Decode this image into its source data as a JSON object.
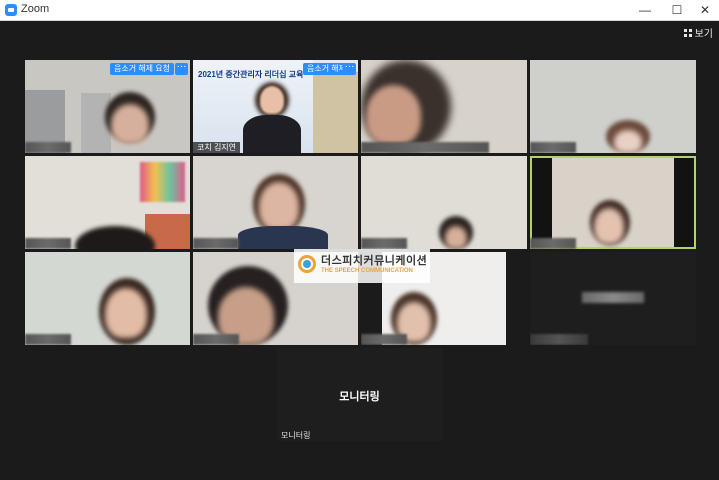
{
  "window": {
    "title": "Zoom",
    "minimize_icon": "minimize-icon",
    "maximize_icon": "maximize-icon",
    "close_icon": "close-icon"
  },
  "toolbar": {
    "view_label": "보기",
    "view_icon": "grid-view-icon"
  },
  "tiles": {
    "t1": {
      "unmute_request": "음소거 해제 요청",
      "more": "···"
    },
    "t2": {
      "banner": "2021년 중간관리자 리더십 교육",
      "unmute": "음소거 해제",
      "more": "···",
      "name": "코치 김지연"
    },
    "monitor": {
      "center_label": "모니터링",
      "name": "모니터링"
    }
  },
  "watermark": {
    "korean": "더스피치커뮤니케이션",
    "english": "THE SPEECH COMMUNICATION"
  },
  "colors": {
    "accent": "#2d8cff",
    "active_speaker": "#b5d26a"
  }
}
